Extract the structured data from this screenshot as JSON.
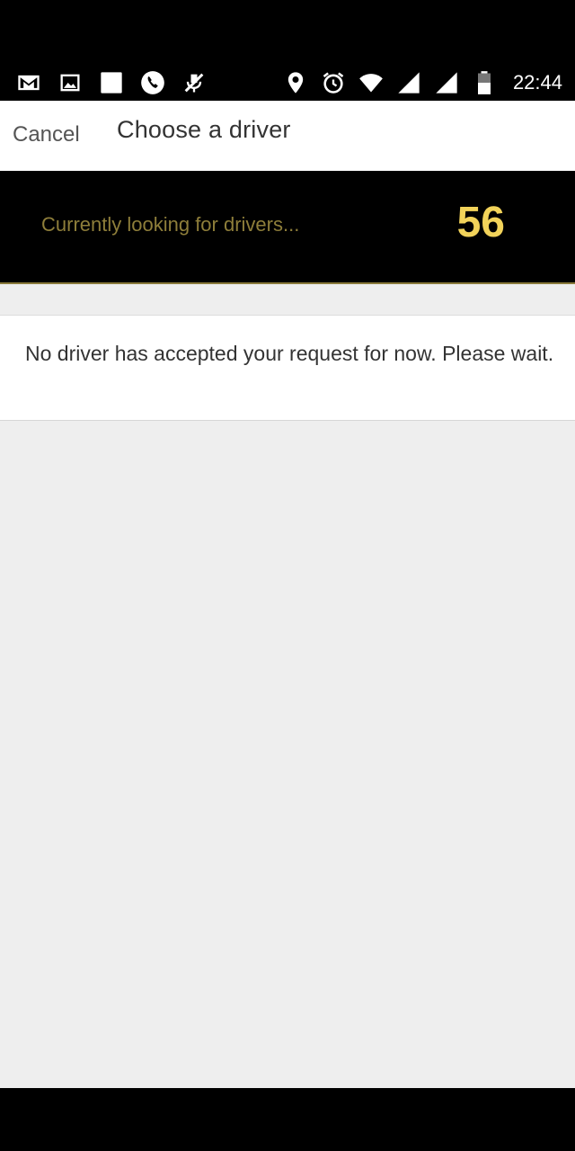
{
  "status_bar": {
    "time": "22:44",
    "left_icons": [
      "gmail-icon",
      "gallery-icon",
      "blank-notification-icon",
      "phone-call-icon",
      "mic-off-icon"
    ],
    "right_icons": [
      "location-pin-icon",
      "alarm-icon",
      "wifi-icon",
      "signal-icon",
      "signal-icon",
      "battery-icon"
    ]
  },
  "header": {
    "cancel_label": "Cancel",
    "title": "Choose a driver"
  },
  "banner": {
    "status_text": "Currently looking for drivers...",
    "countdown": "56"
  },
  "message": {
    "text": "No driver has accepted your request for now. Please wait."
  },
  "colors": {
    "banner_bg": "#000000",
    "banner_text": "#8e7e3a",
    "countdown": "#f2d35a",
    "content_bg": "#eeeeee"
  }
}
